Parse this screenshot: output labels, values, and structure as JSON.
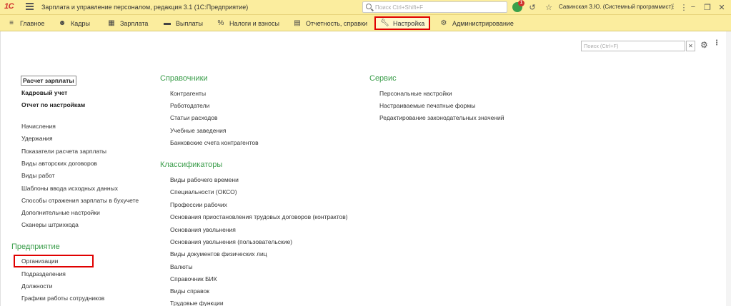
{
  "titlebar": {
    "logo": "1С",
    "app_title": "Зарплата и управление персоналом, редакция 3.1  (1С:Предприятие)",
    "search_placeholder": "Поиск Ctrl+Shift+F",
    "notification_count": "1",
    "user": "Савинская З.Ю. (Системный программист)"
  },
  "sections": [
    {
      "label": "Главное",
      "icon": "menu-icon"
    },
    {
      "label": "Кадры",
      "icon": "people-icon"
    },
    {
      "label": "Зарплата",
      "icon": "calculator-icon"
    },
    {
      "label": "Выплаты",
      "icon": "cash-icon"
    },
    {
      "label": "Налоги и взносы",
      "icon": "percent-icon"
    },
    {
      "label": "Отчетность, справки",
      "icon": "document-icon"
    },
    {
      "label": "Настройка",
      "icon": "wrench-icon"
    },
    {
      "label": "Администрирование",
      "icon": "gear-icon"
    }
  ],
  "content": {
    "search_placeholder": "Поиск (Ctrl+F)",
    "col1": {
      "bold_items": [
        "Расчет зарплаты",
        "Кадровый учет",
        "Отчет по настройкам"
      ],
      "items": [
        "Начисления",
        "Удержания",
        "Показатели расчета зарплаты",
        "Виды авторских договоров",
        "Виды работ",
        "Шаблоны ввода исходных данных",
        "Способы отражения зарплаты в бухучете",
        "Дополнительные настройки",
        "Сканеры штрихкода"
      ],
      "group_title": "Предприятие",
      "group_items": [
        "Организации",
        "Подразделения",
        "Должности",
        "Графики работы сотрудников"
      ]
    },
    "col2": {
      "group1_title": "Справочники",
      "group1_items": [
        "Контрагенты",
        "Работодатели",
        "Статьи расходов",
        "Учебные заведения",
        "Банковские счета контрагентов"
      ],
      "group2_title": "Классификаторы",
      "group2_items": [
        "Виды рабочего времени",
        "Специальности (ОКСО)",
        "Профессии рабочих",
        "Основания приостановления трудовых договоров (контрактов)",
        "Основания увольнения",
        "Основания увольнения (пользовательские)",
        "Виды документов физических лиц",
        "Валюты",
        "Справочник БИК",
        "Виды справок",
        "Трудовые функции"
      ]
    },
    "col3": {
      "group_title": "Сервис",
      "items": [
        "Персональные настройки",
        "Настраиваемые печатные формы",
        "Редактирование законодательных значений"
      ]
    }
  }
}
